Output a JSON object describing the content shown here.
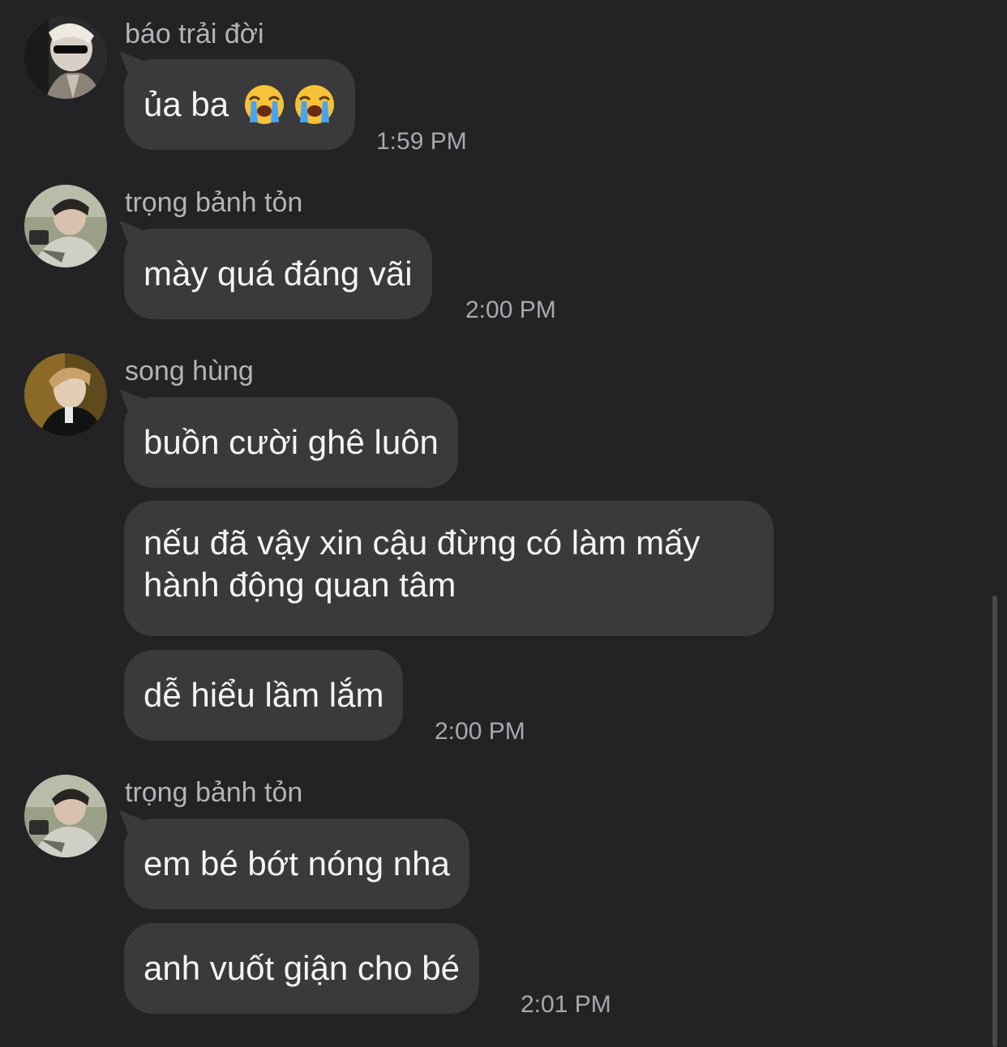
{
  "messages": [
    {
      "sender": "báo trải đời",
      "avatar_icon": "avatar-bao-trai-doi",
      "bubbles": [
        {
          "text": "ủa ba",
          "emoji": [
            "loudly-crying-face",
            "loudly-crying-face"
          ]
        }
      ],
      "time": "1:59 PM"
    },
    {
      "sender": "trọng bảnh tỏn",
      "avatar_icon": "avatar-trong-banh-ton",
      "bubbles": [
        {
          "text": "mày quá đáng vãi"
        }
      ],
      "time": "2:00 PM"
    },
    {
      "sender": "song hùng",
      "avatar_icon": "avatar-song-hung",
      "bubbles": [
        {
          "text": "buồn cười ghê luôn"
        },
        {
          "text": "nếu đã vậy xin cậu đừng có làm mấy hành động quan tâm"
        },
        {
          "text": "dễ hiểu lầm lắm"
        }
      ],
      "time": "2:00 PM"
    },
    {
      "sender": "trọng bảnh tỏn",
      "avatar_icon": "avatar-trong-banh-ton",
      "bubbles": [
        {
          "text": "em bé bớt nóng nha"
        },
        {
          "text": "anh vuốt giận cho bé"
        }
      ],
      "time": "2:01 PM"
    }
  ],
  "colors": {
    "background": "#232325",
    "bubble": "#3a3a3d",
    "sender_text": "#b4b4b8",
    "timestamp_text": "#a8a8ad"
  }
}
